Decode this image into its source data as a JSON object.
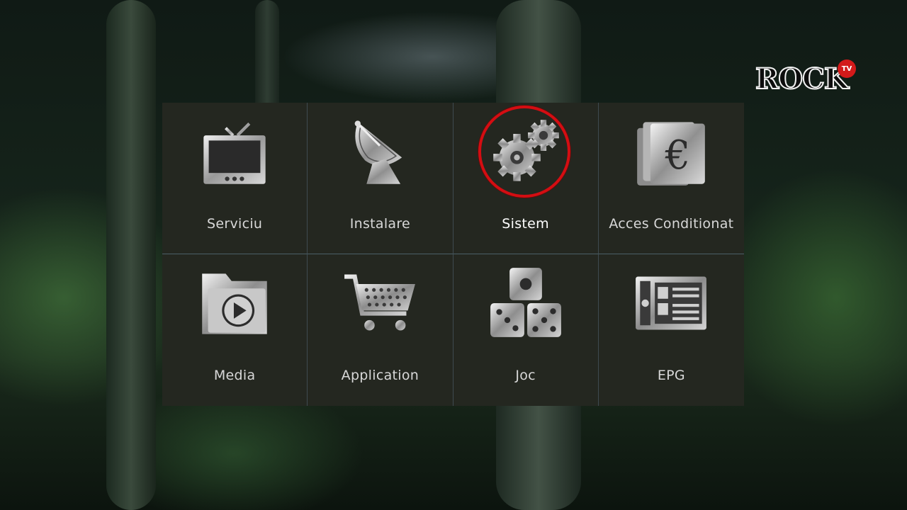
{
  "channel_logo": {
    "text": "ROCK",
    "badge": "TV",
    "badge_color": "#d31a1a"
  },
  "menu": {
    "selected_color": "#d40d12",
    "items": [
      {
        "label": "Serviciu",
        "icon": "tv-icon",
        "selected": false
      },
      {
        "label": "Instalare",
        "icon": "satellite-dish-icon",
        "selected": false
      },
      {
        "label": "Sistem",
        "icon": "gears-icon",
        "selected": true
      },
      {
        "label": "Acces Conditionat",
        "icon": "euro-cards-icon",
        "selected": false
      },
      {
        "label": "Media",
        "icon": "media-folder-icon",
        "selected": false
      },
      {
        "label": "Application",
        "icon": "shopping-cart-icon",
        "selected": false
      },
      {
        "label": "Joc",
        "icon": "dice-icon",
        "selected": false
      },
      {
        "label": "EPG",
        "icon": "epg-guide-icon",
        "selected": false
      }
    ]
  }
}
